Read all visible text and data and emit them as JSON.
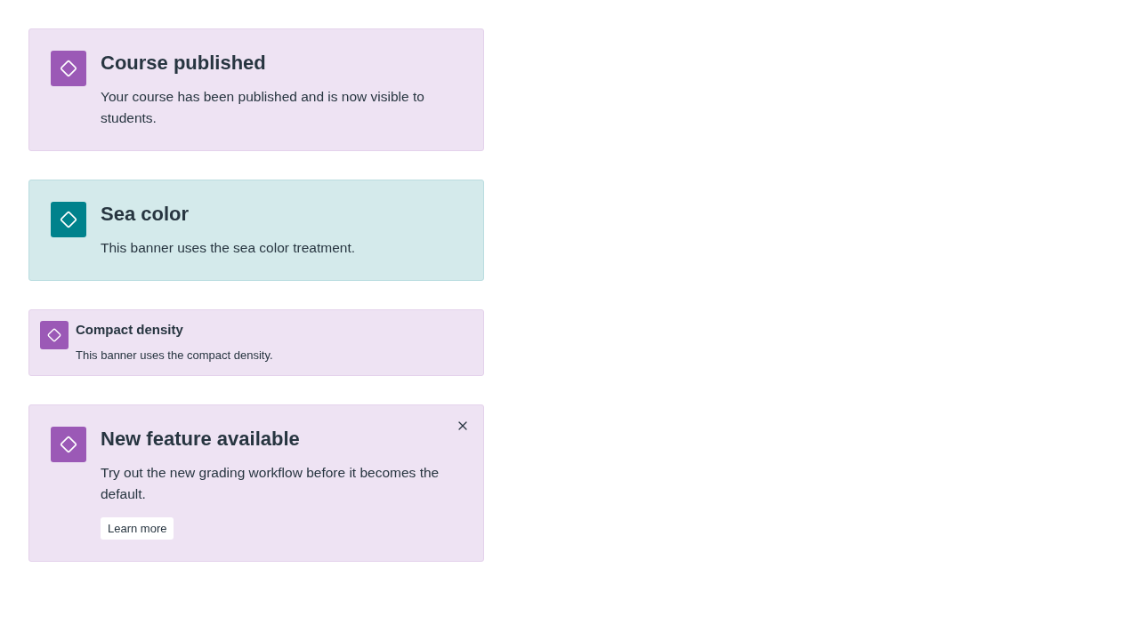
{
  "banners": [
    {
      "color": "#9b59b6",
      "kind": "standard",
      "title": "Course published",
      "message": "Your course has been published and is now visible to students.",
      "dismissible": false
    },
    {
      "color": "#00828c",
      "kind": "standard",
      "title": "Sea color",
      "message": "This banner uses the sea color treatment.",
      "dismissible": false
    },
    {
      "color": "#9b59b6",
      "kind": "compact",
      "title": "Compact density",
      "message": "This banner uses the compact density.",
      "dismissible": false
    },
    {
      "color": "#9b59b6",
      "kind": "standard",
      "title": "New feature available",
      "message": "Try out the new grading workflow before it becomes the default.",
      "dismissible": true,
      "action": "Learn more"
    }
  ]
}
